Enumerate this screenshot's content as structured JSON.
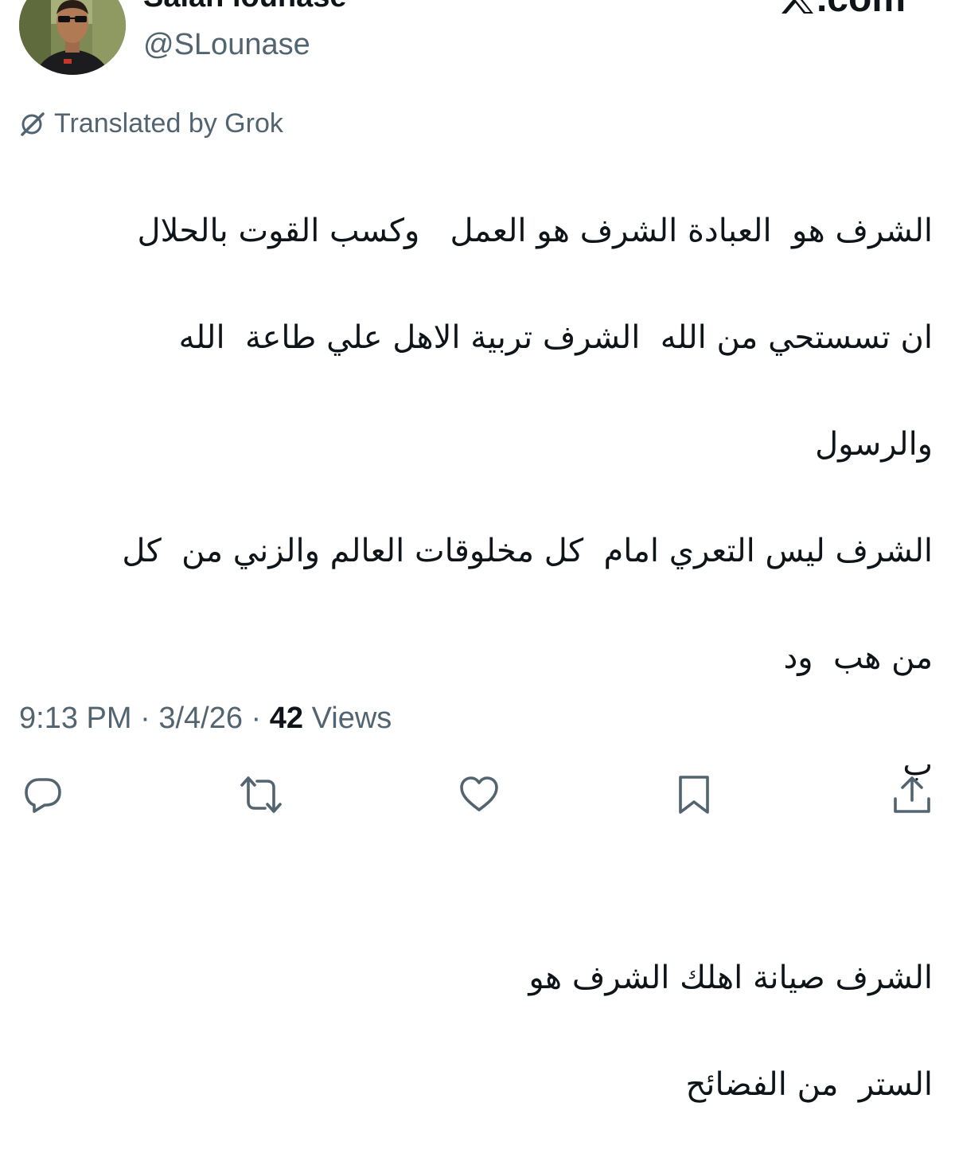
{
  "user": {
    "display_name": "Salah lounase",
    "handle": "@SLounase"
  },
  "brand": {
    "icon": "x-logo-icon",
    "label": ".com"
  },
  "translation": {
    "icon": "grok-icon",
    "label": "Translated by Grok"
  },
  "tweet": {
    "lines": [
      "الشرف هو  العبادة الشرف هو العمل   وكسب القوت بالحلال",
      "ان تسستحي من الله  الشرف تربية الاهل علي طاعة  الله",
      "والرسول",
      "الشرف ليس التعري امام  كل مخلوقات العالم والزني من  كل",
      "من هب  ود",
      "ب",
      "",
      "الشرف صيانة اهلك الشرف هو",
      "الستر  من الفضائح"
    ]
  },
  "meta": {
    "time": "9:13 PM",
    "separator": "·",
    "date": "3/4/26",
    "views_count": "42",
    "views_label": "Views"
  },
  "actions": {
    "reply": "reply-icon",
    "repost": "repost-icon",
    "like": "like-icon",
    "bookmark": "bookmark-icon",
    "share": "share-icon"
  },
  "colors": {
    "text": "#0f1419",
    "secondary": "#536471"
  }
}
